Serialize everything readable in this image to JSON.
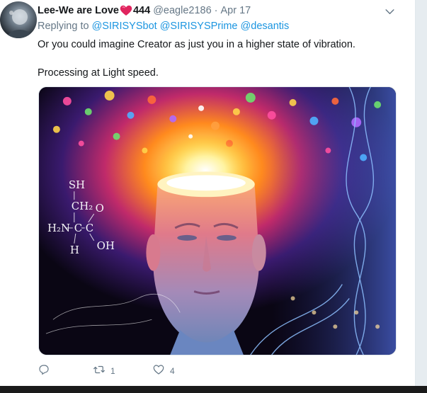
{
  "tweet": {
    "display_name": "Lee-We are Love",
    "display_name_suffix": "444",
    "handle": "@eagle2186",
    "separator": "·",
    "date": "Apr 17",
    "replying_to_label": "Replying to",
    "replying_to": [
      "@SIRISYSbot",
      "@SIRISYSPrime",
      "@desantis"
    ],
    "body": [
      "Or you could imagine Creator as just you in a higher state of vibration.",
      "Processing at Light speed."
    ],
    "image_labels": {
      "formula_sh": "SH",
      "formula_ch2": "CH₂",
      "formula_h2n": "H₂N",
      "formula_c1": "C",
      "formula_c2": "C",
      "formula_oh": "OH",
      "formula_o": "O",
      "formula_h": "H"
    },
    "actions": {
      "reply_count": "",
      "retweet_count": "1",
      "like_count": "4"
    }
  },
  "colors": {
    "link": "#1b95e0",
    "secondary_text": "#657786",
    "heart": "#e0245e"
  },
  "icons": {
    "caret": "chevron-down-icon",
    "reply": "reply-icon",
    "retweet": "retweet-icon",
    "like": "heart-outline-icon",
    "emoji": "red-heart-emoji"
  }
}
